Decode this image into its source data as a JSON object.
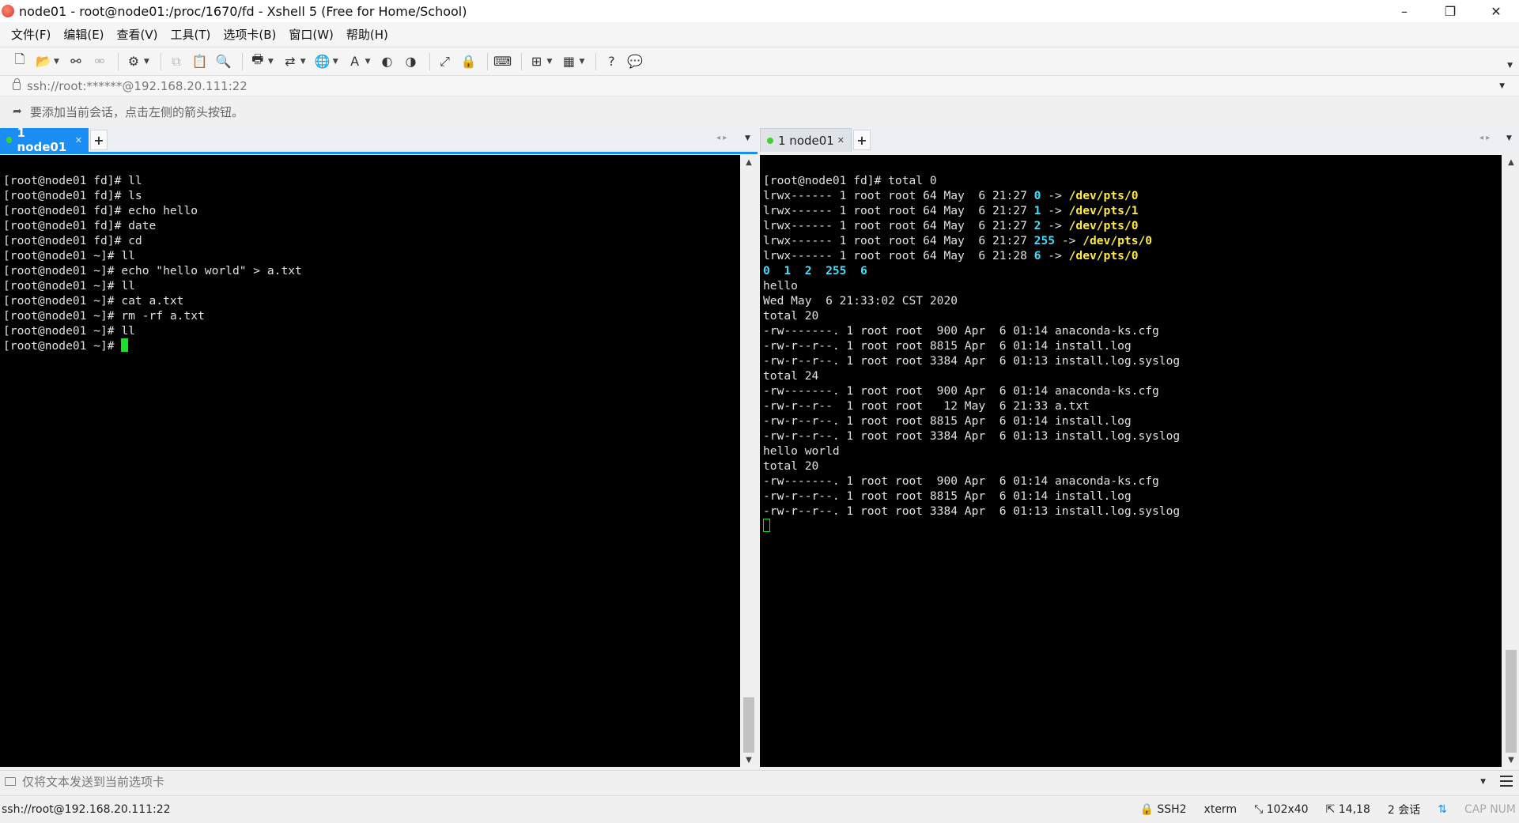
{
  "window": {
    "title": "node01 - root@node01:/proc/1670/fd - Xshell 5 (Free for Home/School)",
    "minimize": "–",
    "maximize": "❐",
    "close": "✕"
  },
  "menu": [
    "文件(F)",
    "编辑(E)",
    "查看(V)",
    "工具(T)",
    "选项卡(B)",
    "窗口(W)",
    "帮助(H)"
  ],
  "address": {
    "text": "ssh://root:******@192.168.20.111:22"
  },
  "hint": {
    "text": "要添加当前会话，点击左侧的箭头按钮。"
  },
  "left_pane": {
    "tab_label": "1 node01",
    "lines": [
      "[root@node01 fd]# ll",
      "[root@node01 fd]# ls",
      "[root@node01 fd]# echo hello",
      "[root@node01 fd]# date",
      "[root@node01 fd]# cd",
      "[root@node01 ~]# ll",
      "[root@node01 ~]# echo \"hello world\" > a.txt",
      "[root@node01 ~]# ll",
      "[root@node01 ~]# cat a.txt",
      "[root@node01 ~]# rm -rf a.txt",
      "[root@node01 ~]# ll"
    ],
    "prompt": "[root@node01 ~]# "
  },
  "right_pane": {
    "tab_label": "1 node01",
    "line0": "[root@node01 fd]# total 0",
    "links": [
      {
        "prefix": "lrwx------ 1 root root 64 May  6 21:27 ",
        "fd": "0",
        "arrow": " -> ",
        "target": "/dev/pts/0"
      },
      {
        "prefix": "lrwx------ 1 root root 64 May  6 21:27 ",
        "fd": "1",
        "arrow": " -> ",
        "target": "/dev/pts/1"
      },
      {
        "prefix": "lrwx------ 1 root root 64 May  6 21:27 ",
        "fd": "2",
        "arrow": " -> ",
        "target": "/dev/pts/0"
      },
      {
        "prefix": "lrwx------ 1 root root 64 May  6 21:27 ",
        "fd": "255",
        "arrow": " -> ",
        "target": "/dev/pts/0"
      },
      {
        "prefix": "lrwx------ 1 root root 64 May  6 21:28 ",
        "fd": "6",
        "arrow": " -> ",
        "target": "/dev/pts/0"
      }
    ],
    "fd_list": "0  1  2  255  6",
    "lines": [
      "hello",
      "Wed May  6 21:33:02 CST 2020",
      "total 20",
      "-rw-------. 1 root root  900 Apr  6 01:14 anaconda-ks.cfg",
      "-rw-r--r--. 1 root root 8815 Apr  6 01:14 install.log",
      "-rw-r--r--. 1 root root 3384 Apr  6 01:13 install.log.syslog",
      "total 24",
      "-rw-------. 1 root root  900 Apr  6 01:14 anaconda-ks.cfg",
      "-rw-r--r--  1 root root   12 May  6 21:33 a.txt",
      "-rw-r--r--. 1 root root 8815 Apr  6 01:14 install.log",
      "-rw-r--r--. 1 root root 3384 Apr  6 01:13 install.log.syslog",
      "hello world",
      "total 20",
      "-rw-------. 1 root root  900 Apr  6 01:14 anaconda-ks.cfg",
      "-rw-r--r--. 1 root root 8815 Apr  6 01:14 install.log",
      "-rw-r--r--. 1 root root 3384 Apr  6 01:13 install.log.syslog"
    ]
  },
  "compose": {
    "text": "仅将文本发送到当前选项卡"
  },
  "status": {
    "left": "ssh://root@192.168.20.111:22",
    "protocol": "SSH2",
    "term": "xterm",
    "size": "102x40",
    "cursor": "14,18",
    "sessions": "2 会话",
    "keys": "CAP  NUM"
  },
  "colors": {
    "accent": "#1a8ef5",
    "terminal_bg": "#000000",
    "cursor": "#19e029",
    "fd_cyan": "#3fe0ff",
    "target_yellow": "#ffea40"
  }
}
